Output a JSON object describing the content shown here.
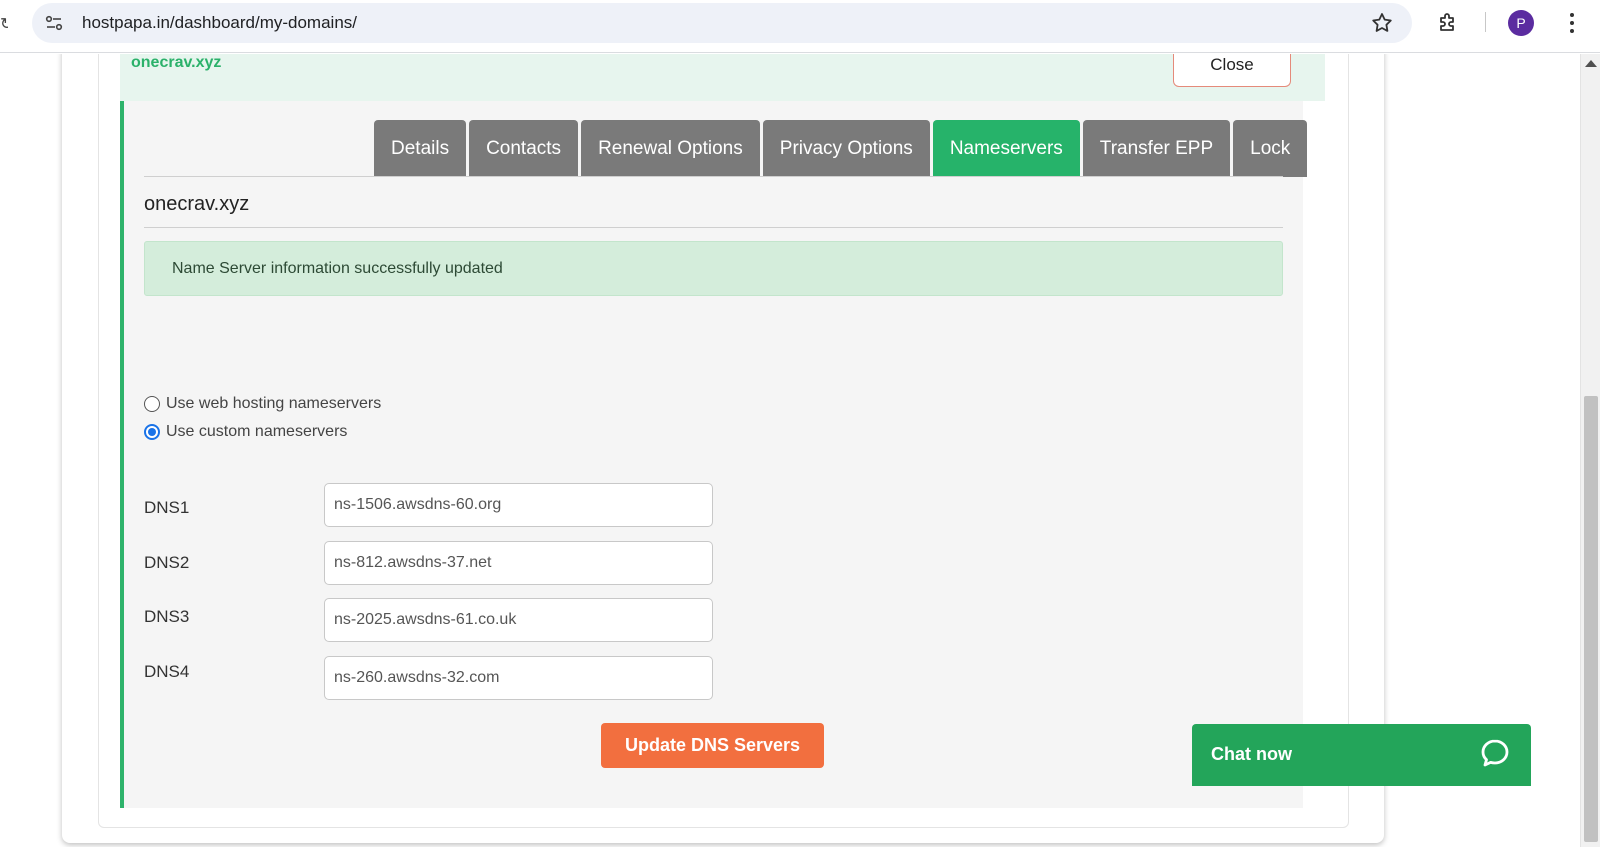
{
  "browser": {
    "url": "hostpapa.in/dashboard/my-domains/",
    "profile_initial": "P",
    "icons": [
      "site-info-icon",
      "star-icon",
      "extensions-icon",
      "kebab-menu-icon"
    ]
  },
  "domain_header": {
    "name": "onecrav.xyz",
    "close_label": "Close"
  },
  "tabs": [
    {
      "label": "Details",
      "active": false
    },
    {
      "label": "Contacts",
      "active": false
    },
    {
      "label": "Renewal Options",
      "active": false
    },
    {
      "label": "Privacy Options",
      "active": false
    },
    {
      "label": "Nameservers",
      "active": true
    },
    {
      "label": "Transfer EPP",
      "active": false
    },
    {
      "label": "Lock",
      "active": false
    }
  ],
  "section": {
    "title": "onecrav.xyz",
    "alert": "Name Server information successfully updated"
  },
  "nameserver_options": [
    {
      "label": "Use web hosting nameservers",
      "checked": false
    },
    {
      "label": "Use custom nameservers",
      "checked": true
    }
  ],
  "dns": [
    {
      "label": "DNS1",
      "value": "ns-1506.awsdns-60.org"
    },
    {
      "label": "DNS2",
      "value": "ns-812.awsdns-37.net"
    },
    {
      "label": "DNS3",
      "value": "ns-2025.awsdns-61.co.uk"
    },
    {
      "label": "DNS4",
      "value": "ns-260.awsdns-32.com"
    }
  ],
  "update_button": "Update DNS Servers",
  "chat": {
    "label": "Chat now"
  },
  "colors": {
    "accent_green": "#26b36a",
    "tab_gray": "#7a7a7a",
    "update_orange": "#f26f3f",
    "alert_bg": "#d4eddb",
    "chat_green": "#23a55a"
  }
}
